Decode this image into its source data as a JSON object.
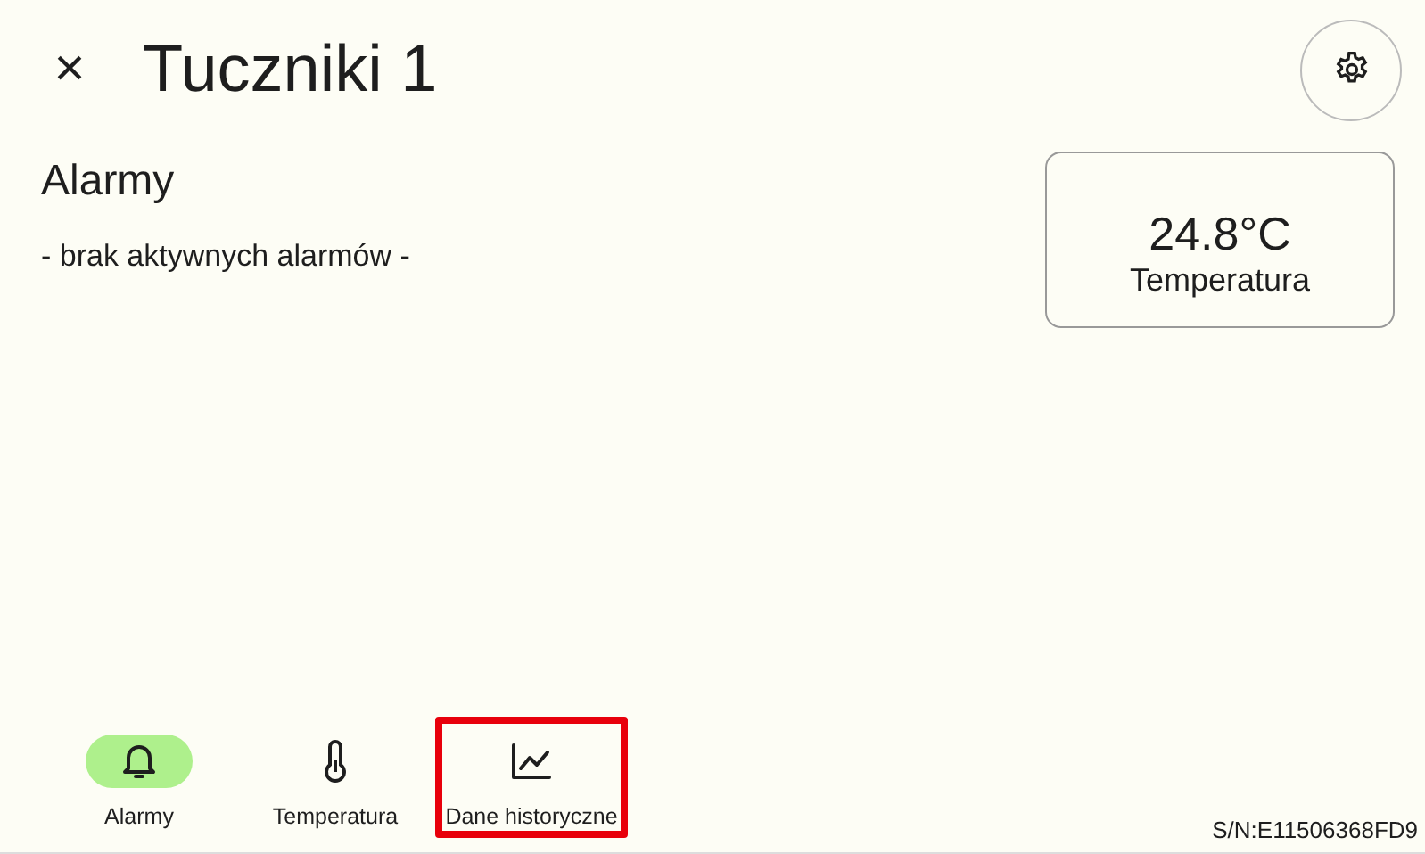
{
  "header": {
    "close": "×",
    "title": "Tuczniki 1"
  },
  "alarms": {
    "heading": "Alarmy",
    "empty_text": "- brak aktywnych alarmów -"
  },
  "tile": {
    "value": "24.8°C",
    "label": "Temperatura"
  },
  "nav": [
    {
      "kind": "bell",
      "label": "Alarmy",
      "selected": true,
      "highlighted": false
    },
    {
      "kind": "thermometer",
      "label": "Temperatura",
      "selected": false,
      "highlighted": false
    },
    {
      "kind": "chart",
      "label": "Dane historyczne",
      "selected": false,
      "highlighted": true
    }
  ],
  "serial": "S/N:E11506368FD9"
}
